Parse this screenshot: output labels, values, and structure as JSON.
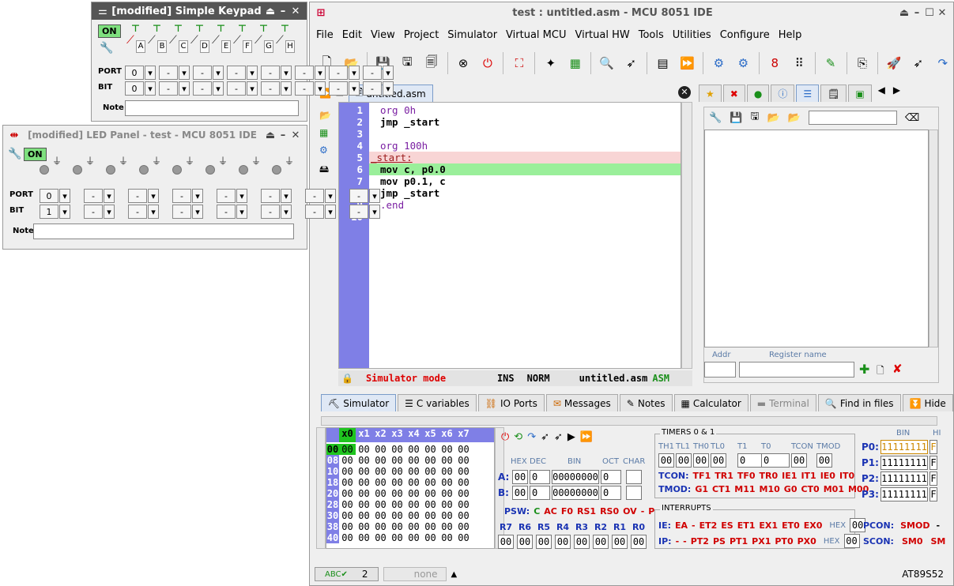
{
  "main": {
    "title": "test : untitled.asm - MCU 8051 IDE",
    "menu": [
      "File",
      "Edit",
      "View",
      "Project",
      "Simulator",
      "Virtual MCU",
      "Virtual HW",
      "Tools",
      "Utilities",
      "Configure",
      "Help"
    ],
    "editor_tab": "untitled.asm",
    "code": [
      {
        "n": "1",
        "text": "org 0h"
      },
      {
        "n": "2",
        "text": "jmp _start"
      },
      {
        "n": "3",
        "text": ""
      },
      {
        "n": "4",
        "text": "org 100h"
      },
      {
        "n": "5",
        "text": "_start:"
      },
      {
        "n": "6",
        "text": "mov c, p0.0"
      },
      {
        "n": "7",
        "text": "mov p0.1, c"
      },
      {
        "n": "8",
        "text": "jmp _start"
      },
      {
        "n": "9",
        "text": ".end"
      },
      {
        "n": "10",
        "text": ""
      }
    ],
    "status": {
      "mode": "Simulator mode",
      "ins": "INS",
      "norm": "NORM",
      "file": "untitled.asm",
      "type": "ASM"
    },
    "right_panel": {
      "addr_label": "Addr",
      "regname_label": "Register name"
    },
    "bottom_tabs": [
      "Simulator",
      "C variables",
      "IO Ports",
      "Messages",
      "Notes",
      "Calculator",
      "Terminal",
      "Find in files",
      "Hide"
    ],
    "memory": {
      "header": [
        "x0",
        "x1",
        "x2",
        "x3",
        "x4",
        "x5",
        "x6",
        "x7"
      ],
      "rows": [
        "00",
        "08",
        "10",
        "18",
        "20",
        "28",
        "30",
        "38",
        "40"
      ],
      "value": "00"
    },
    "regs": {
      "hex": "HEX",
      "dec": "DEC",
      "bin": "BIN",
      "oct": "OCT",
      "char": "CHAR",
      "a_label": "A:",
      "a_hex": "00",
      "a_dec": "0",
      "a_bin": "00000000",
      "a_oct": "0",
      "b_label": "B:",
      "b_hex": "00",
      "b_dec": "0",
      "b_bin": "00000000",
      "b_oct": "0",
      "psw_label": "PSW:",
      "psw": [
        "C",
        "AC",
        "F0",
        "RS1",
        "RS0",
        "OV",
        "-",
        "P"
      ],
      "rnames": [
        "R7",
        "R6",
        "R5",
        "R4",
        "R3",
        "R2",
        "R1",
        "R0"
      ],
      "rval": "00"
    },
    "timers": {
      "title": "TIMERS 0 & 1",
      "heads": [
        "TH1",
        "TL1",
        "TH0",
        "TL0",
        "T1",
        "T0",
        "TCON",
        "TMOD"
      ],
      "vals": [
        "00",
        "00",
        "00",
        "00",
        "0",
        "0",
        "00",
        "00"
      ],
      "tcon_label": "TCON:",
      "tcon": [
        "TF1",
        "TR1",
        "TF0",
        "TR0",
        "IE1",
        "IT1",
        "IE0",
        "IT0"
      ],
      "tmod_label": "TMOD:",
      "tmod": [
        "G1",
        "CT1",
        "M11",
        "M10",
        "G0",
        "CT0",
        "M01",
        "M00"
      ]
    },
    "interrupts": {
      "title": "INTERRUPTS",
      "ie_label": "IE:",
      "ie": [
        "EA",
        "-",
        "ET2",
        "ES",
        "ET1",
        "EX1",
        "ET0",
        "EX0"
      ],
      "ie_hex": "00",
      "ip_label": "IP:",
      "ip": [
        "-",
        "-",
        "PT2",
        "PS",
        "PT1",
        "PX1",
        "PT0",
        "PX0"
      ],
      "ip_hex": "00",
      "hex": "HEX"
    },
    "ports": {
      "bin": "BIN",
      "hi": "HI",
      "items": [
        {
          "name": "P0:",
          "val": "11111111",
          "hv": "F"
        },
        {
          "name": "P1:",
          "val": "11111111",
          "hv": "F"
        },
        {
          "name": "P2:",
          "val": "11111111",
          "hv": "F"
        },
        {
          "name": "P3:",
          "val": "11111111",
          "hv": "F"
        }
      ],
      "pcon_label": "PCON:",
      "pcon": [
        "SMOD",
        "-"
      ],
      "scon_label": "SCON:",
      "scon": [
        "SM0",
        "SM"
      ]
    },
    "footer": {
      "count": "2",
      "none": "none",
      "mcu": "AT89S52"
    }
  },
  "keypad": {
    "title": "[modified] Simple Keypad",
    "on": "ON",
    "keys": [
      "A",
      "B",
      "C",
      "D",
      "E",
      "F",
      "G",
      "H"
    ],
    "port_label": "PORT",
    "bit_label": "BIT",
    "port_first": "0",
    "bit_first": "0",
    "dash": "-",
    "note_label": "Note"
  },
  "ledpanel": {
    "title": "[modified] LED Panel - test - MCU 8051 IDE",
    "on": "ON",
    "port_label": "PORT",
    "bit_label": "BIT",
    "port_first": "0",
    "bit_first": "1",
    "dash": "-",
    "note_label": "Note"
  }
}
